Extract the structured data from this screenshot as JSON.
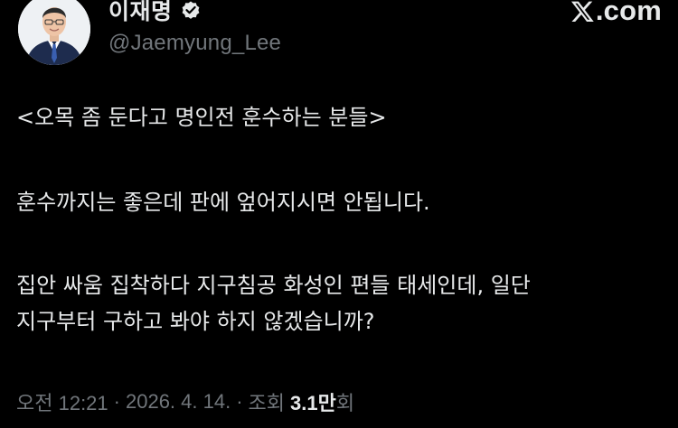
{
  "author": {
    "display_name": "이재명",
    "handle": "@Jaemyung_Lee",
    "verified_icon": "verified-badge-icon",
    "avatar_icon": "avatar"
  },
  "site_logo": {
    "icon": "x-logo-icon",
    "domain_text": ".com"
  },
  "tweet": {
    "paragraph_1": "<오목 좀 둔다고 명인전 훈수하는 분들>",
    "paragraph_2": "훈수까지는 좋은데 판에 엎어지시면 안됩니다.",
    "paragraph_3_line_1": "집안 싸움 집착하다 지구침공 화성인 편들 태세인데, 일단",
    "paragraph_3_line_2": "지구부터 구하고 봐야 하지 않겠습니까?"
  },
  "meta": {
    "time": "오전 12:21",
    "separator": "·",
    "date": "2026. 4. 14.",
    "views_label": "조회",
    "views_count": "3.1만",
    "views_suffix": "회"
  },
  "colors": {
    "background": "#000000",
    "primary_text": "#e7e9ea",
    "secondary_text": "#71767b",
    "verified_badge": "#e7e9ea"
  }
}
